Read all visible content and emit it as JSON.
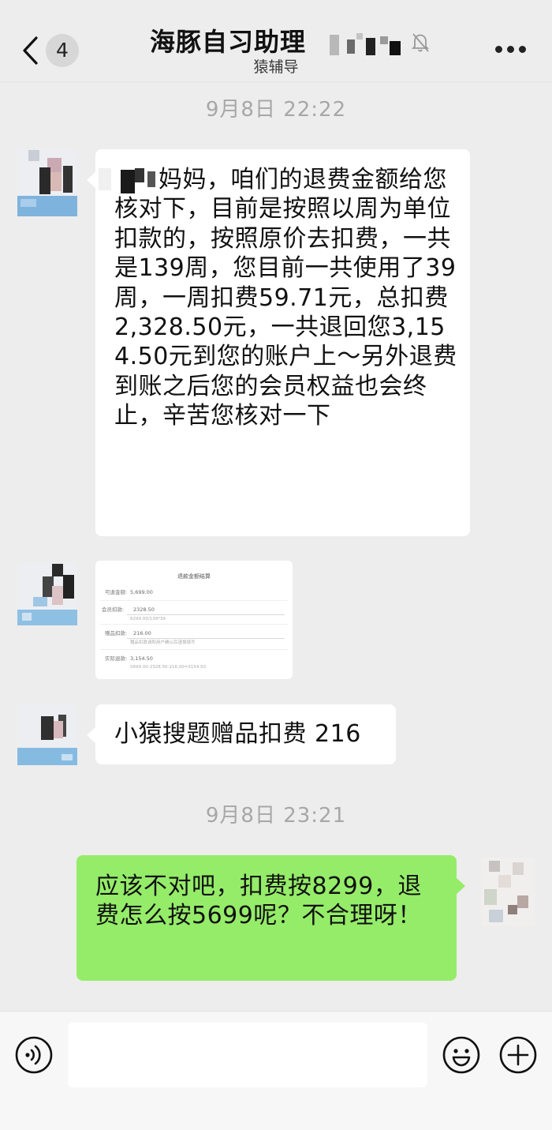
{
  "header": {
    "unread_count": "4",
    "title": "海豚自习助理",
    "subtitle": "猿辅导"
  },
  "timestamps": [
    "9月8日 22:22",
    "9月8日 23:21"
  ],
  "messages": [
    {
      "from": "other",
      "type": "text",
      "text": "妈妈，咱们的退费金额给您核对下，目前是按照以周为单位扣款的，按照原价去扣费，一共是139周，您目前一共使用了39周，一周扣费59.71元，总扣费2,328.50元，一共退回您3,154.50元到您的账户上～另外退费到账之后您的会员权益也会终止，辛苦您核对一下"
    },
    {
      "from": "other",
      "type": "image",
      "card": {
        "title": "退款金额结算",
        "rows": [
          {
            "label": "可退金额:",
            "value": "5,699.00"
          },
          {
            "label": "会员扣款:",
            "value": "2328.50",
            "note": "8299.00/139*39"
          },
          {
            "label": "赠品扣款:",
            "value": "216.00",
            "note": "赠品扣款请和用户确认后谨慎填写"
          },
          {
            "label": "实际退款:",
            "value": "3,154.50",
            "note": "5699.00-2328.50-216.00=3154.50"
          }
        ]
      }
    },
    {
      "from": "other",
      "type": "text",
      "text": "小猿搜题赠品扣费 216"
    },
    {
      "from": "me",
      "type": "text",
      "text": "应该不对吧，扣费按8299，退费怎么按5699呢？不合理呀！"
    }
  ],
  "icons": {
    "back": "chevron-left-icon",
    "mute": "bell-off-icon",
    "more": "more-dots-icon",
    "voice": "voice-icon",
    "emoji": "emoji-icon",
    "plus": "plus-icon"
  },
  "colors": {
    "background": "#ededed",
    "incoming_bubble": "#ffffff",
    "outgoing_bubble": "#95ec69",
    "timestamp": "#a7a7a7",
    "input_bar": "#f7f7f7"
  }
}
